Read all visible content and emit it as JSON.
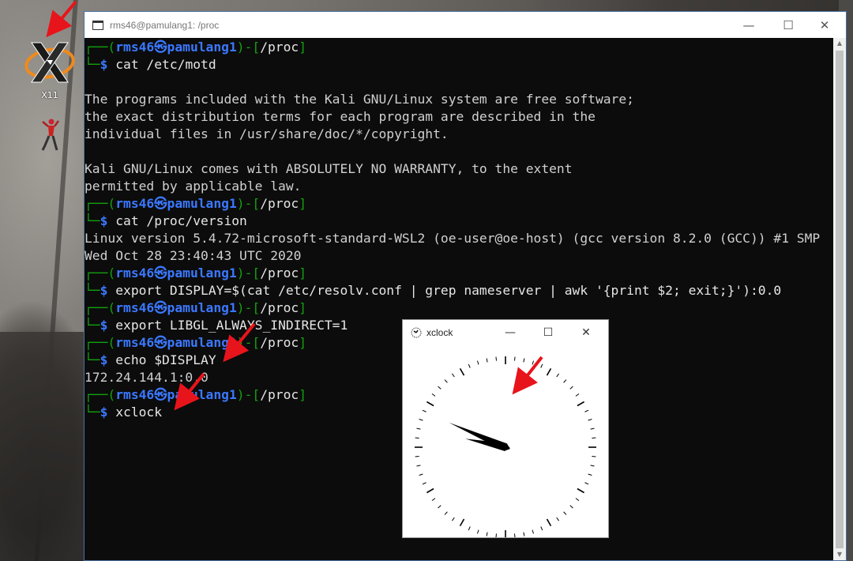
{
  "desktop": {
    "icons": [
      {
        "name": "x11",
        "label": "X11"
      },
      {
        "name": "climber",
        "label": ""
      }
    ]
  },
  "terminal": {
    "title": "rms46@pamulang1: /proc",
    "controls": {
      "minimize": "—",
      "maximize": "☐",
      "close": "✕"
    },
    "prompt": {
      "user": "rms46",
      "sep": "㉿",
      "host": "pamulang1",
      "dir": "/proc",
      "symbol": "$"
    },
    "lines": [
      {
        "type": "prompt",
        "prefix": "┌──(",
        "user": "rms46",
        "sep": "㉿",
        "host": "pamulang1",
        "mid": ")-[",
        "dir": "/proc",
        "suffix": "]"
      },
      {
        "type": "cmd",
        "prefix": "└─",
        "symbol": "$",
        "text": " cat /etc/motd"
      },
      {
        "type": "out",
        "text": ""
      },
      {
        "type": "out",
        "text": "The programs included with the Kali GNU/Linux system are free software;"
      },
      {
        "type": "out",
        "text": "the exact distribution terms for each program are described in the"
      },
      {
        "type": "out",
        "text": "individual files in /usr/share/doc/*/copyright."
      },
      {
        "type": "out",
        "text": ""
      },
      {
        "type": "out",
        "text": "Kali GNU/Linux comes with ABSOLUTELY NO WARRANTY, to the extent"
      },
      {
        "type": "out",
        "text": "permitted by applicable law."
      },
      {
        "type": "prompt",
        "prefix": "┌──(",
        "user": "rms46",
        "sep": "㉿",
        "host": "pamulang1",
        "mid": ")-[",
        "dir": "/proc",
        "suffix": "]"
      },
      {
        "type": "cmd",
        "prefix": "└─",
        "symbol": "$",
        "text": " cat /proc/version"
      },
      {
        "type": "out",
        "text": "Linux version 5.4.72-microsoft-standard-WSL2 (oe-user@oe-host) (gcc version 8.2.0 (GCC)) #1 SMP"
      },
      {
        "type": "out",
        "text": "Wed Oct 28 23:40:43 UTC 2020"
      },
      {
        "type": "prompt",
        "prefix": "┌──(",
        "user": "rms46",
        "sep": "㉿",
        "host": "pamulang1",
        "mid": ")-[",
        "dir": "/proc",
        "suffix": "]"
      },
      {
        "type": "cmd",
        "prefix": "└─",
        "symbol": "$",
        "text": " export DISPLAY=$(cat /etc/resolv.conf | grep nameserver | awk '{print $2; exit;}'):0.0"
      },
      {
        "type": "prompt",
        "prefix": "┌──(",
        "user": "rms46",
        "sep": "㉿",
        "host": "pamulang1",
        "mid": ")-[",
        "dir": "/proc",
        "suffix": "]"
      },
      {
        "type": "cmd",
        "prefix": "└─",
        "symbol": "$",
        "text": " export LIBGL_ALWAYS_INDIRECT=1"
      },
      {
        "type": "prompt",
        "prefix": "┌──(",
        "user": "rms46",
        "sep": "㉿",
        "host": "pamulang1",
        "mid": ")-[",
        "dir": "/proc",
        "suffix": "]"
      },
      {
        "type": "cmd",
        "prefix": "└─",
        "symbol": "$",
        "text": " echo $DISPLAY"
      },
      {
        "type": "out",
        "text": "172.24.144.1:0.0"
      },
      {
        "type": "prompt",
        "prefix": "┌──(",
        "user": "rms46",
        "sep": "㉿",
        "host": "pamulang1",
        "mid": ")-[",
        "dir": "/proc",
        "suffix": "]"
      },
      {
        "type": "cmd",
        "prefix": "└─",
        "symbol": "$",
        "text": " xclock"
      }
    ]
  },
  "xclock": {
    "title": "xclock",
    "controls": {
      "minimize": "—",
      "maximize": "☐",
      "close": "✕"
    },
    "time": {
      "hour": 9,
      "minute": 47
    }
  },
  "colors": {
    "prompt_green": "#13a10e",
    "prompt_blue": "#3b78ff",
    "terminal_bg": "#0c0c0c",
    "annotation_red": "#e8141b"
  }
}
